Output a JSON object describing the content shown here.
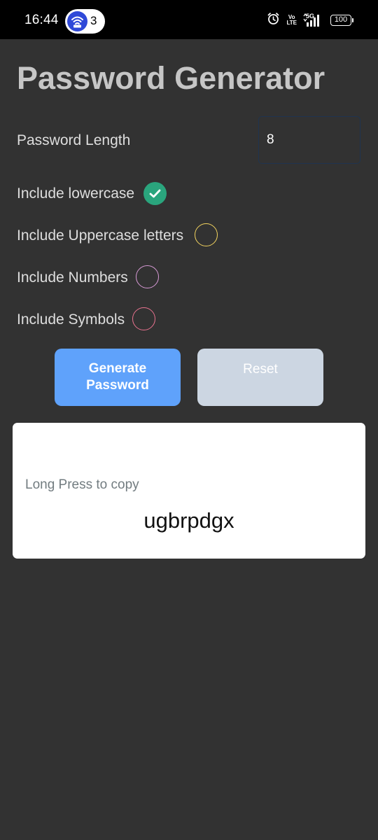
{
  "status_bar": {
    "time": "16:44",
    "hotspot_count": "3",
    "volte_top": "Vo",
    "volte_bottom": "LTE",
    "network": "5G",
    "battery": "100",
    "icons": [
      "wifi-hotspot-icon",
      "alarm-icon",
      "volte-icon",
      "signal-5g-icon",
      "signal-bars-icon",
      "battery-icon"
    ]
  },
  "app": {
    "title": "Password Generator",
    "length": {
      "label": "Password Length",
      "value": "8"
    },
    "options": [
      {
        "label": "Include lowercase",
        "checked": true,
        "color": "#2aa57d"
      },
      {
        "label": "Include Uppercase letters",
        "checked": false,
        "color": "#f2d35f"
      },
      {
        "label": "Include Numbers",
        "checked": false,
        "color": "#d89ad6"
      },
      {
        "label": "Include Symbols",
        "checked": false,
        "color": "#e8728f"
      }
    ],
    "buttons": {
      "generate_line1": "Generate",
      "generate_line2": "Password",
      "reset": "Reset"
    },
    "result": {
      "hint": "Long Press to copy",
      "password": "ugbrpdgx"
    }
  },
  "colors": {
    "background": "#323232",
    "title": "#c6c6c6",
    "generate_button": "#5fa2fb",
    "reset_button": "#ccd6e2",
    "card": "#ffffff"
  }
}
